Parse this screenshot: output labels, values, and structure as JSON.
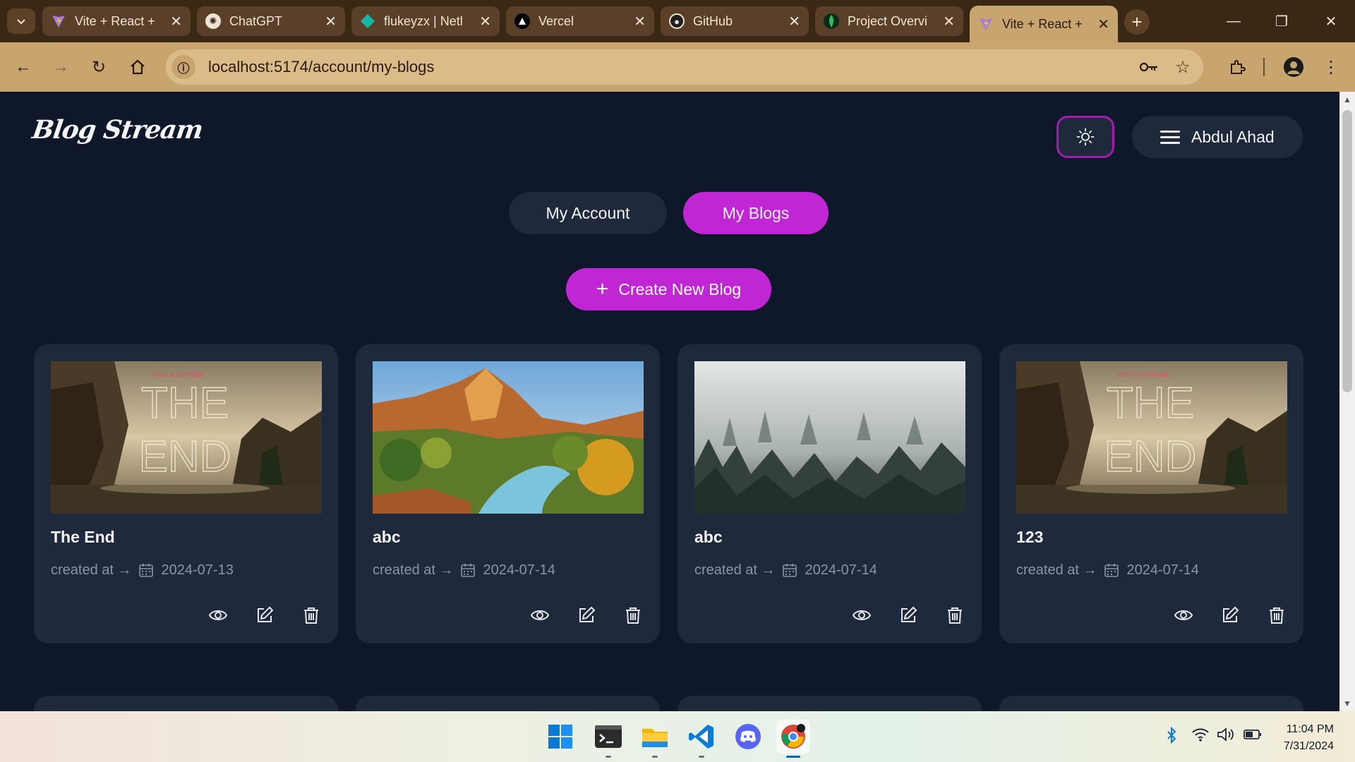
{
  "browser": {
    "tabs": [
      {
        "title": "Vite + React +",
        "icon": "vite-icon",
        "active": false
      },
      {
        "title": "ChatGPT",
        "icon": "chatgpt-icon",
        "active": false
      },
      {
        "title": "flukeyzx | Netl",
        "icon": "netlify-icon",
        "active": false
      },
      {
        "title": "Vercel",
        "icon": "vercel-icon",
        "active": false
      },
      {
        "title": "GitHub",
        "icon": "github-icon",
        "active": false
      },
      {
        "title": "Project Overvi",
        "icon": "mongodb-icon",
        "active": false
      },
      {
        "title": "Vite + React +",
        "icon": "vite-icon",
        "active": true
      }
    ],
    "url": "localhost:5174/account/my-blogs"
  },
  "header": {
    "logo": "Blog Stream",
    "user_name": "Abdul Ahad"
  },
  "nav": {
    "my_account": "My Account",
    "my_blogs": "My Blogs"
  },
  "create_button": "Create New Blog",
  "created_label": "created at →",
  "blogs": [
    {
      "title": "The End",
      "date": "2024-07-13",
      "image": "the-end-poster"
    },
    {
      "title": "abc",
      "date": "2024-07-14",
      "image": "canyon-river"
    },
    {
      "title": "abc",
      "date": "2024-07-14",
      "image": "misty-forest"
    },
    {
      "title": "123",
      "date": "2024-07-14",
      "image": "the-end-poster"
    }
  ],
  "poster_text": {
    "small": "JOSHUA COSTUME",
    "big1": "THE",
    "big2": "END"
  },
  "taskbar": {
    "time": "11:04 PM",
    "date": "7/31/2024",
    "apps": [
      "windows-start-icon",
      "terminal-icon",
      "file-explorer-icon",
      "vscode-icon",
      "discord-icon",
      "chrome-icon"
    ]
  },
  "colors": {
    "page_bg": "#0f172a",
    "card_bg": "#1e293b",
    "accent": "#c026d3",
    "chrome_bg": "#c8a46e"
  }
}
